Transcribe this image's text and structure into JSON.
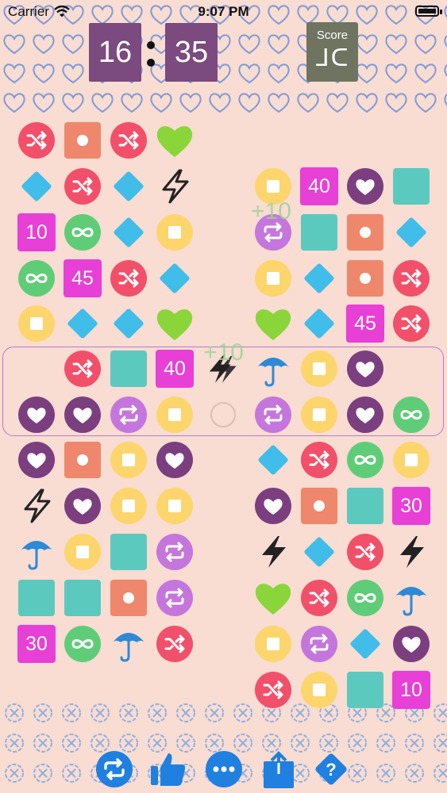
{
  "status_bar": {
    "carrier": "Carrier",
    "time": "9:07 PM"
  },
  "timer": {
    "minutes": "16",
    "seconds": "35"
  },
  "score": {
    "label": "Score",
    "value_glyph": "ᒧᑕ"
  },
  "colors": {
    "background": "#f9dcd2",
    "purple_timer": "#7b4a7f",
    "score_box": "#6e7460",
    "red": "#f2506a",
    "orange": "#ee876c",
    "yellow": "#fcd66c",
    "green_heart": "#8ad63a",
    "blue_diamond": "#40bde8",
    "magenta": "#e83fd6",
    "infinity_green": "#5fcd78",
    "teal": "#5cc9bf",
    "lavender": "#c576dc",
    "plum": "#7b3f80",
    "umbrella_blue": "#2d8ad6",
    "toolbar_blue": "#1f80e0"
  },
  "effects": {
    "bonus_a": "+10",
    "bonus_b": "+10"
  },
  "tile_numbers": {
    "n10": "10",
    "n40": "40",
    "n45": "45",
    "n30": "30"
  },
  "toolbar": {
    "items": [
      {
        "name": "shuffle-button",
        "icon": "repeat-arrows-icon"
      },
      {
        "name": "like-button",
        "icon": "thumbs-up-icon"
      },
      {
        "name": "more-button",
        "icon": "ellipsis-icon"
      },
      {
        "name": "share-button",
        "icon": "share-icon"
      },
      {
        "name": "help-button",
        "icon": "question-icon"
      }
    ]
  }
}
